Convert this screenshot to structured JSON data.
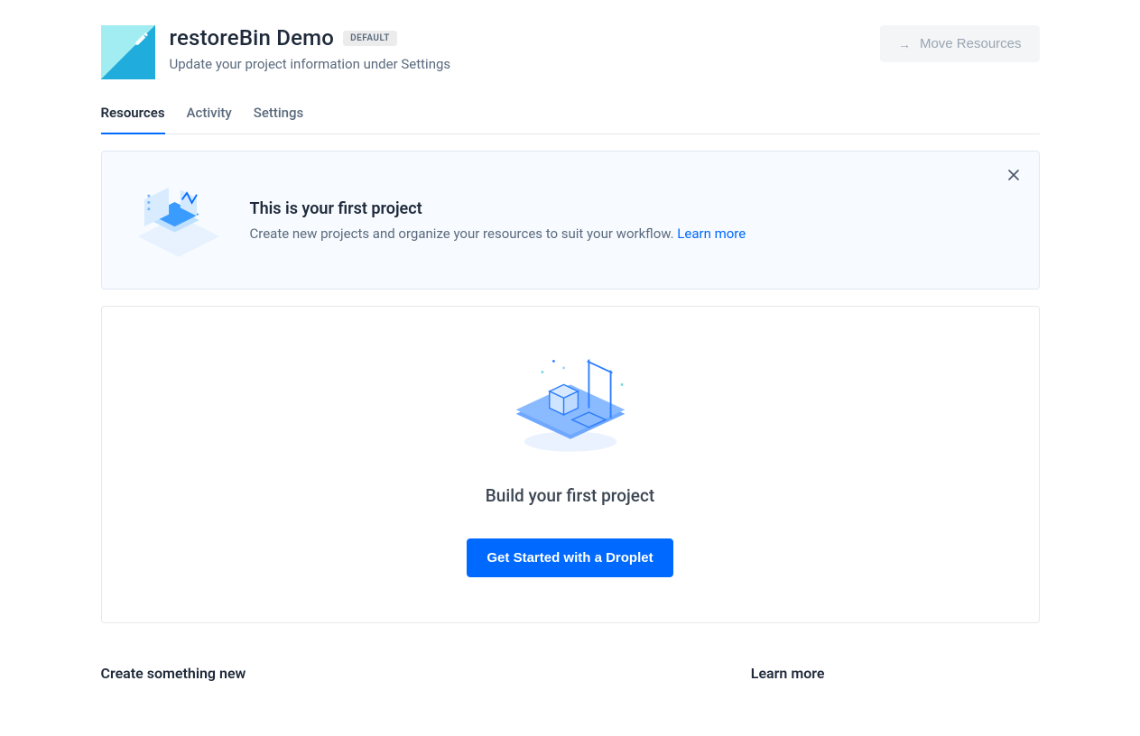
{
  "header": {
    "title": "restoreBin Demo",
    "badge": "DEFAULT",
    "subtitle": "Update your project information under Settings",
    "move_button": "Move Resources"
  },
  "tabs": [
    {
      "label": "Resources",
      "active": true
    },
    {
      "label": "Activity",
      "active": false
    },
    {
      "label": "Settings",
      "active": false
    }
  ],
  "banner": {
    "title": "This is your first project",
    "description": "Create new projects and organize your resources to suit your workflow. ",
    "learn_more": "Learn more"
  },
  "empty_state": {
    "title": "Build your first project",
    "cta": "Get Started with a Droplet"
  },
  "sections": {
    "create": "Create something new",
    "learn": "Learn more"
  }
}
